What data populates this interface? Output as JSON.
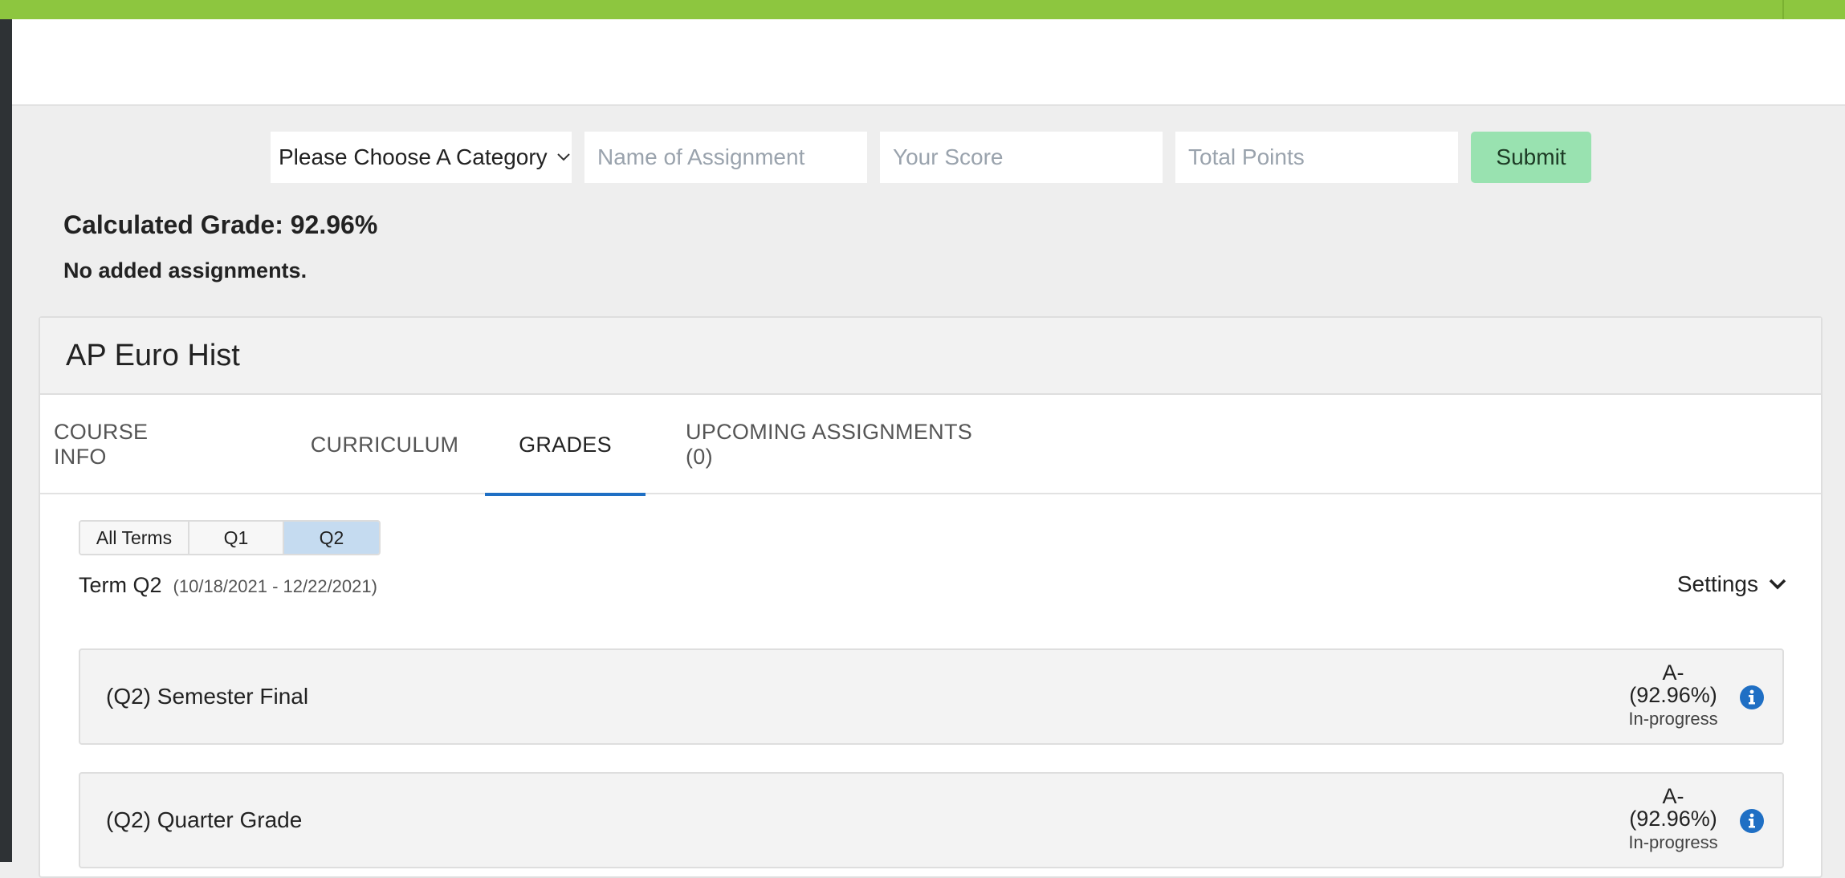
{
  "calculator": {
    "category_select": "Please Choose A Category",
    "assignment_placeholder": "Name of Assignment",
    "score_placeholder": "Your Score",
    "total_placeholder": "Total Points",
    "submit_label": "Submit",
    "calculated_grade": "Calculated Grade: 92.96%",
    "added_status": "No added assignments."
  },
  "course": {
    "title": "AP Euro Hist",
    "tabs": [
      {
        "label": "COURSE INFO"
      },
      {
        "label": "CURRICULUM"
      },
      {
        "label": "GRADES"
      },
      {
        "label": "UPCOMING ASSIGNMENTS (0)"
      }
    ],
    "active_tab": "GRADES",
    "terms": [
      {
        "label": "All Terms"
      },
      {
        "label": "Q1"
      },
      {
        "label": "Q2"
      }
    ],
    "active_term": "Q2",
    "term_label": "Term Q2",
    "term_dates": "(10/18/2021 - 12/22/2021)",
    "settings_label": "Settings",
    "grades": [
      {
        "name": "(Q2) Semester Final",
        "letter": "A-",
        "percent": "(92.96%)",
        "status": "In-progress"
      },
      {
        "name": "(Q2) Quarter Grade",
        "letter": "A-",
        "percent": "(92.96%)",
        "status": "In-progress"
      }
    ]
  },
  "colors": {
    "top_bar": "#8dc63f",
    "submit": "#99e2b0",
    "active_tab_underline": "#1f6fc4",
    "active_term": "#c5dbf0",
    "info_icon": "#1f6fc4"
  },
  "icons": {
    "select_chevron": "chevron-down-icon",
    "settings_chevron": "chevron-down-icon",
    "grade_info": "info-icon"
  }
}
